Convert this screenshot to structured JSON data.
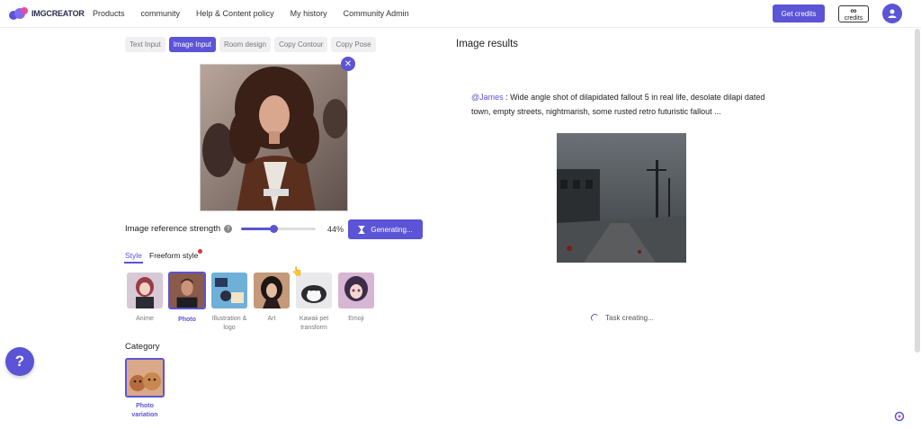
{
  "header": {
    "logo_text": "IMGCREATOR",
    "nav": [
      "Products",
      "community",
      "Help & Content policy",
      "My history",
      "Community Admin"
    ],
    "get_credits": "Get credits",
    "credits_symbol": "∞",
    "credits_label": "credits"
  },
  "input_tabs": [
    {
      "label": "Text Input",
      "active": false
    },
    {
      "label": "Image Input",
      "active": true
    },
    {
      "label": "Room design",
      "active": false
    },
    {
      "label": "Copy Contour",
      "active": false
    },
    {
      "label": "Copy Pose",
      "active": false
    }
  ],
  "strength": {
    "label": "Image reference strength",
    "value_text": "44%",
    "value": 0.44
  },
  "generate_button": "Generating...",
  "style_tabs": {
    "style": "Style",
    "freeform": "Freeform style"
  },
  "styles": [
    {
      "label": "Anime",
      "selected": false
    },
    {
      "label": "Photo",
      "selected": true
    },
    {
      "label": "Illustration & logo",
      "selected": false
    },
    {
      "label": "Art",
      "selected": false
    },
    {
      "label": "Kawaii pet transform",
      "selected": false
    },
    {
      "label": "Emoji",
      "selected": false
    }
  ],
  "category": {
    "title": "Category",
    "item_label": "Photo variation"
  },
  "results": {
    "title": "Image results",
    "prompt_user": "@James",
    "prompt_text": " : Wide angle shot of dilapidated fallout 5 in real life, desolate dilapi dated town, empty streets, nightmarish, some rusted retro futuristic fallout ...",
    "status": "Task creating..."
  },
  "help_fab": "?",
  "colors": {
    "accent": "#5b54d6"
  }
}
